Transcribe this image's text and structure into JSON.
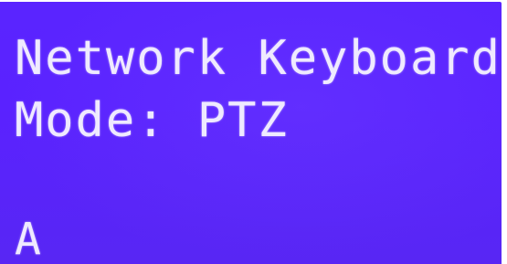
{
  "display": {
    "line1": "Network Keyboard",
    "line2": "Mode: PTZ",
    "line3": "A"
  },
  "colors": {
    "screen_background": "#5a24ff",
    "text": "#efeaff"
  }
}
